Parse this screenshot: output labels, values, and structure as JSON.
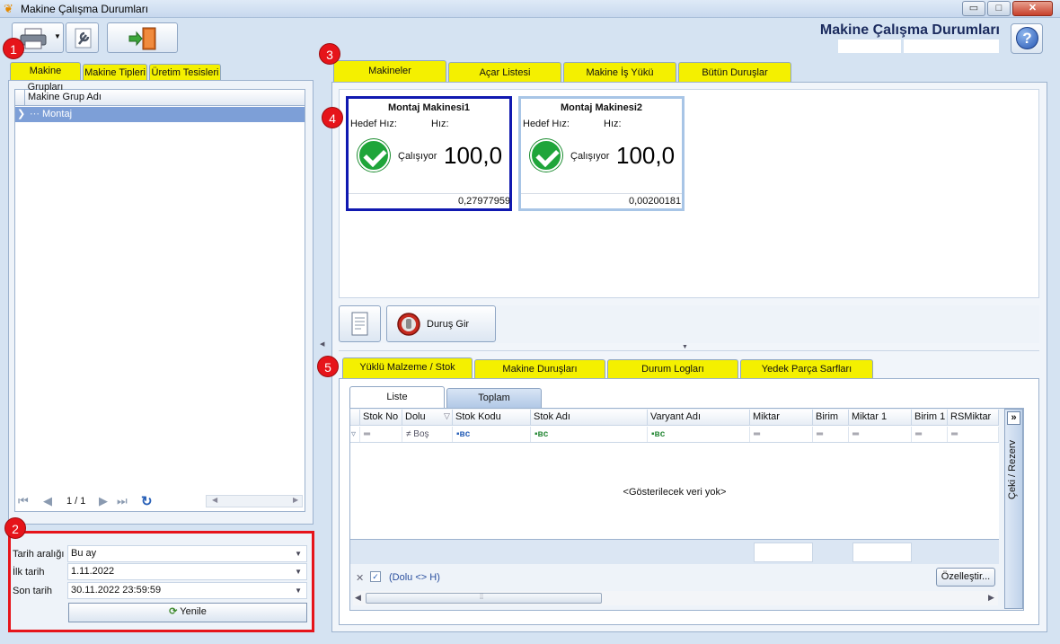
{
  "window": {
    "title": "Makine Çalışma Durumları",
    "controls": [
      "▭",
      "□",
      "✕"
    ]
  },
  "header": {
    "title": "Makine Çalışma Durumları",
    "help_symbol": "?"
  },
  "markers": [
    "1",
    "2",
    "3",
    "4",
    "5"
  ],
  "left_tabs": [
    "Makine Grupları",
    "Makine Tipleri",
    "Üretim Tesisleri"
  ],
  "group_grid": {
    "column": "Makine Grup Adı",
    "rows": [
      "Montaj"
    ],
    "page": "1 / 1"
  },
  "date_filter": {
    "range_label": "Tarih aralığı",
    "range_value": "Bu ay",
    "start_label": "İlk tarih",
    "start_value": "1.11.2022",
    "end_label": "Son tarih",
    "end_value": "30.11.2022 23:59:59",
    "refresh_label": "Yenile"
  },
  "top_tabs": [
    "Makineler",
    "Açar Listesi",
    "Makine İş Yükü",
    "Bütün Duruşlar"
  ],
  "machines": [
    {
      "name": "Montaj Makinesi1",
      "target_label": "Hedef Hız:",
      "speed_label": "Hız:",
      "status": "Çalışıyor",
      "value": "100,0",
      "footer": "0,27977959"
    },
    {
      "name": "Montaj Makinesi2",
      "target_label": "Hedef Hız:",
      "speed_label": "Hız:",
      "status": "Çalışıyor",
      "value": "100,0",
      "footer": "0,00200181"
    }
  ],
  "actions": {
    "stop_entry": "Duruş Gir"
  },
  "bottom_tabs": [
    "Yüklü Malzeme / Stok",
    "Makine Duruşları",
    "Durum Logları",
    "Yedek Parça Sarfları"
  ],
  "sub_tabs": [
    "Liste",
    "Toplam"
  ],
  "stock_grid": {
    "columns": [
      "Stok No",
      "Dolu",
      "Stok Kodu",
      "Stok Adı",
      "Varyant Adı",
      "Miktar",
      "Birim",
      "Miktar 1",
      "Birim 1",
      "RSMiktar"
    ],
    "filter_dolu": "Boş",
    "empty_text": "<Gösterilecek veri yok>",
    "filter_text": "(Dolu <> H)",
    "customize": "Özelleştir...",
    "side_label": "Çeki / Rezerv",
    "expand": "»"
  },
  "colors": {
    "highlight": "#f4f000",
    "marker": "#e6141a",
    "selected": "#7d9fd7",
    "ok": "#1fa53a"
  }
}
